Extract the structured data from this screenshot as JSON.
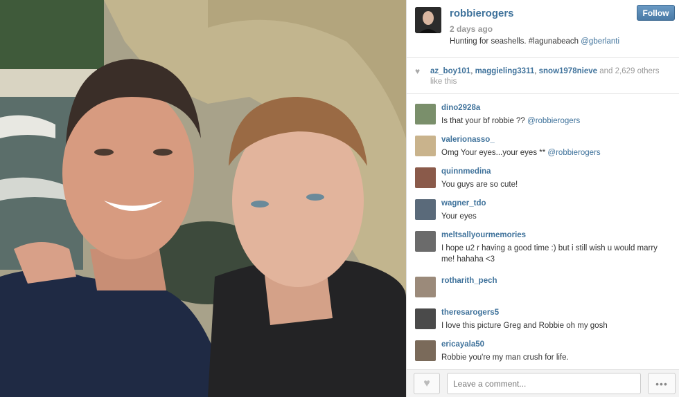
{
  "post": {
    "username": "robbierogers",
    "time_ago": "2 days ago",
    "caption_text": "Hunting for seashells. #lagunabeach",
    "caption_mention": "@gberlanti",
    "follow_label": "Follow"
  },
  "likes": {
    "likers": [
      "az_boy101",
      "maggieling3311",
      "snow1978nieve"
    ],
    "rest_text": "and 2,629 others like this"
  },
  "comments": [
    {
      "user": "dino2928a",
      "text": "Is that your bf robbie ??",
      "mention": "@robbierogers",
      "avatar_color": "#7a8f6b"
    },
    {
      "user": "valerionasso_",
      "text": "Omg Your eyes...your eyes **",
      "mention": "@robbierogers",
      "avatar_color": "#c9b38c"
    },
    {
      "user": "quinnmedina",
      "text": "You guys are so cute!",
      "mention": "",
      "avatar_color": "#8a5a4a"
    },
    {
      "user": "wagner_tdo",
      "text": "Your eyes ",
      "mention": "",
      "avatar_color": "#5a6a7a"
    },
    {
      "user": "meltsallyourmemories",
      "text": "I hope u2 r having a good time :) but i still wish u would marry me! hahaha <3",
      "mention": "",
      "avatar_color": "#6b6b6b"
    },
    {
      "user": "rotharith_pech",
      "text": "",
      "mention": "",
      "avatar_color": "#9b8a7a"
    },
    {
      "user": "theresarogers5",
      "text": "I love this picture Greg and Robbie oh my gosh",
      "mention": "",
      "avatar_color": "#4a4a4a"
    },
    {
      "user": "ericayala50",
      "text": "Robbie you're my man crush for life. ",
      "mention": "",
      "avatar_color": "#7a6a5a"
    }
  ],
  "footer": {
    "comment_placeholder": "Leave a comment..."
  },
  "icons": {
    "heart": "heart-icon",
    "more": "more-icon"
  },
  "colors": {
    "link": "#3f729b",
    "follow_button": "#517fa4"
  }
}
